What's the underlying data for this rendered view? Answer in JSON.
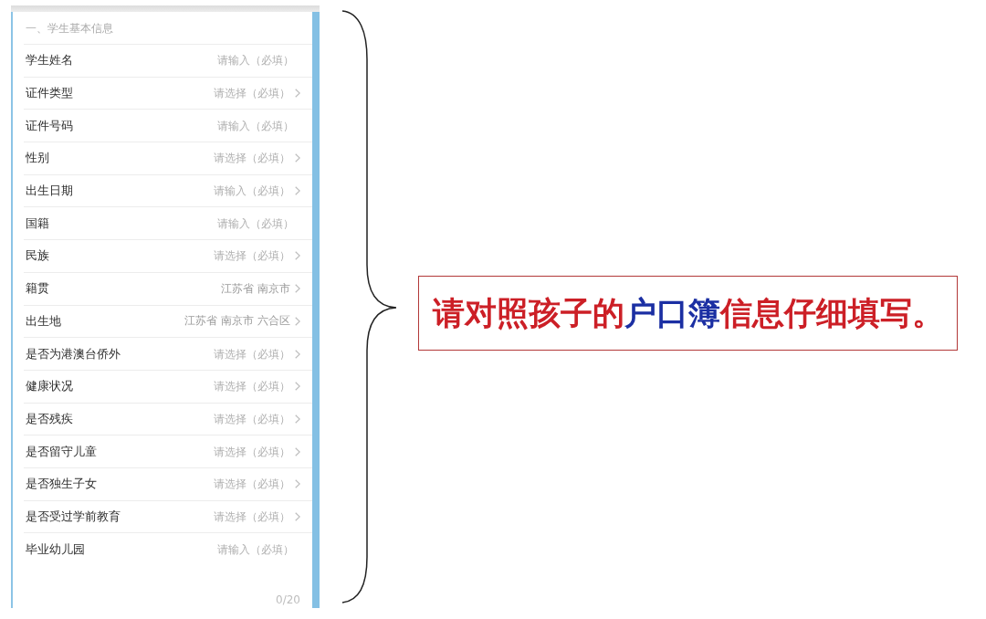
{
  "form": {
    "section_title": "一、学生基本信息",
    "fields": [
      {
        "label": "学生姓名",
        "kind": "input",
        "placeholder": "请输入（必填）"
      },
      {
        "label": "证件类型",
        "kind": "select",
        "placeholder": "请选择（必填）"
      },
      {
        "label": "证件号码",
        "kind": "input",
        "placeholder": "请输入（必填）"
      },
      {
        "label": "性别",
        "kind": "select",
        "placeholder": "请选择（必填）"
      },
      {
        "label": "出生日期",
        "kind": "select",
        "placeholder": "请输入（必填）"
      },
      {
        "label": "国籍",
        "kind": "input",
        "placeholder": "请输入（必填）"
      },
      {
        "label": "民族",
        "kind": "select",
        "placeholder": "请选择（必填）"
      },
      {
        "label": "籍贯",
        "kind": "select",
        "value": "江苏省 南京市"
      },
      {
        "label": "出生地",
        "kind": "select",
        "value": "江苏省 南京市 六合区"
      },
      {
        "label": "是否为港澳台侨外",
        "kind": "select",
        "placeholder": "请选择（必填）"
      },
      {
        "label": "健康状况",
        "kind": "select",
        "placeholder": "请选择（必填）"
      },
      {
        "label": "是否残疾",
        "kind": "select",
        "placeholder": "请选择（必填）"
      },
      {
        "label": "是否留守儿童",
        "kind": "select",
        "placeholder": "请选择（必填）"
      },
      {
        "label": "是否独生子女",
        "kind": "select",
        "placeholder": "请选择（必填）"
      },
      {
        "label": "是否受过学前教育",
        "kind": "select",
        "placeholder": "请选择（必填）"
      },
      {
        "label": "毕业幼儿园",
        "kind": "input",
        "placeholder": "请输入（必填）"
      }
    ],
    "counter": "0/20"
  },
  "callout": {
    "segments": [
      {
        "text": "请对照孩子的",
        "color": "#cc1f26"
      },
      {
        "text": "户口簿",
        "color": "#1b2fa3"
      },
      {
        "text": "信息仔细填写。",
        "color": "#cc1f26"
      }
    ]
  }
}
